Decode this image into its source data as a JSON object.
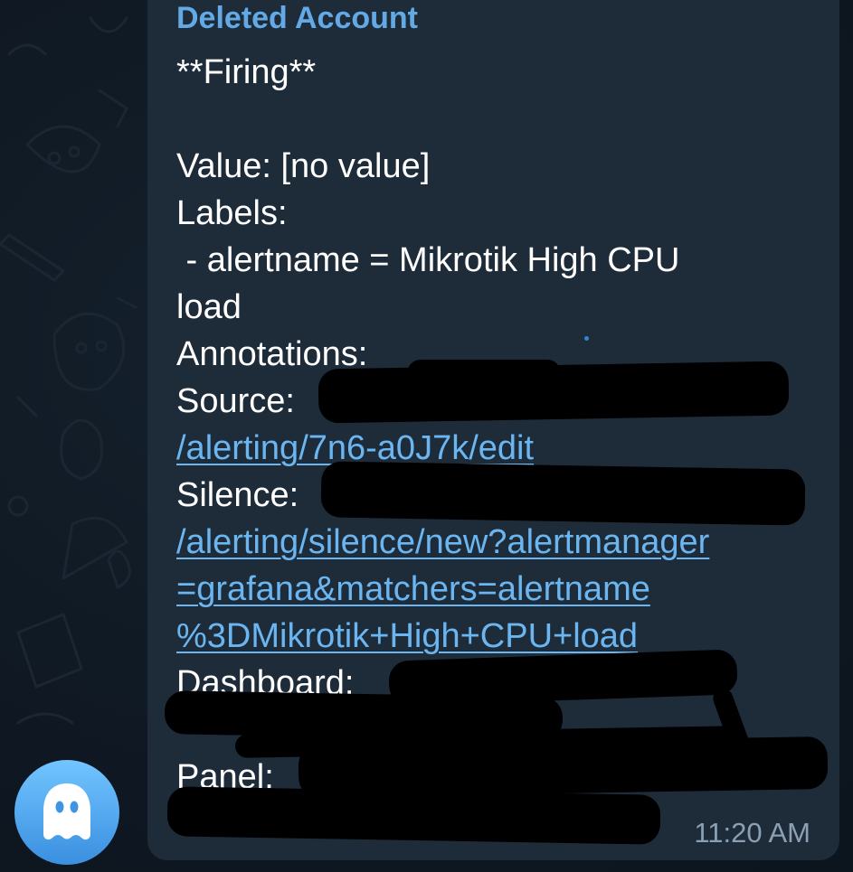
{
  "message": {
    "sender": "Deleted Account",
    "lines": {
      "firing": "**Firing**",
      "value": "Value: [no value]",
      "labels": "Labels:",
      "alertname_1": " - alertname = Mikrotik High CPU",
      "alertname_2": "load",
      "annotations": "Annotations:",
      "source_label": "Source: ",
      "source_link_2": "/alerting/7n6-a0J7k/edit",
      "silence_label": "Silence: ",
      "silence_link_2": "/alerting/silence/new?alertmanager",
      "silence_link_3": "=grafana&matchers=alertname",
      "silence_link_4": "%3DMikrotik+High+CPU+load",
      "dashboard_label": "Dashboard: ",
      "panel_label": "Panel: "
    },
    "time": "11:20 AM"
  },
  "colors": {
    "sender": "#62a9e6",
    "link": "#6bb6f0",
    "bubble": "#1e2c3a",
    "background": "#0e1621",
    "redaction": "#000000"
  },
  "avatar": {
    "icon": "ghost-icon"
  }
}
